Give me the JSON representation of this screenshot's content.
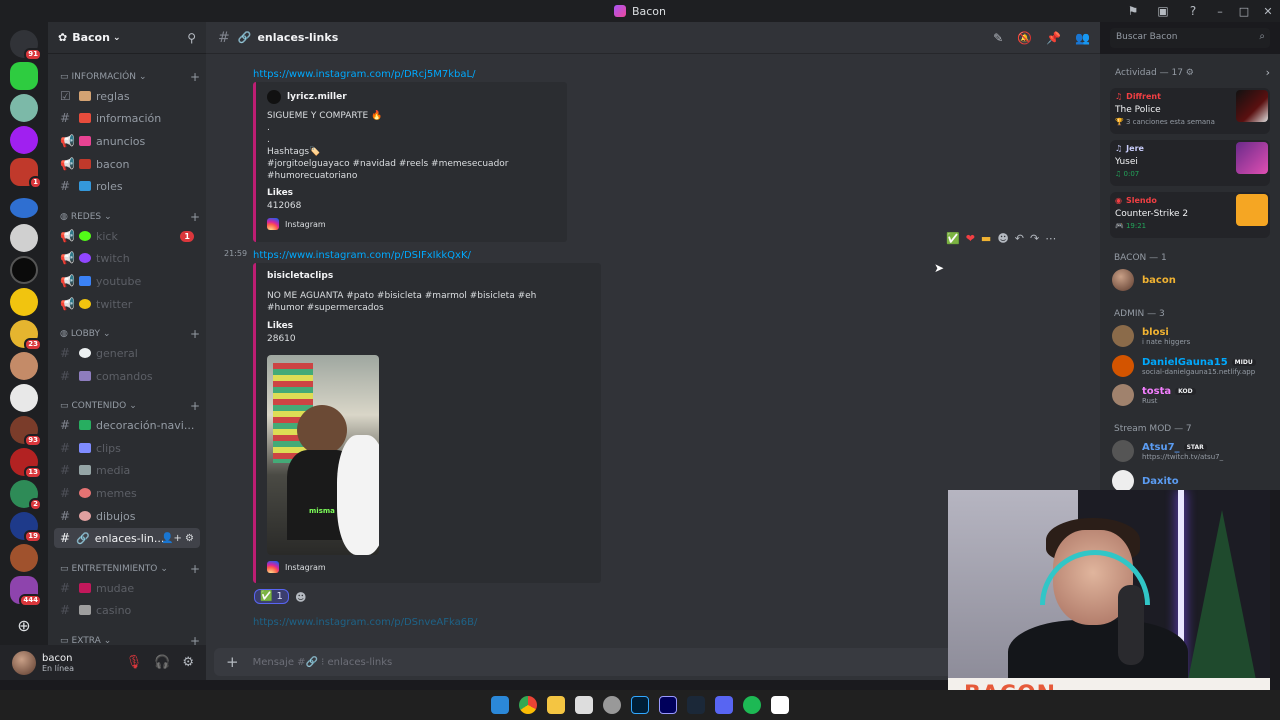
{
  "window": {
    "title": "Bacon"
  },
  "server": {
    "name": "Bacon"
  },
  "categories": [
    {
      "label": "INFORMACIÓN"
    },
    {
      "label": "REDES"
    },
    {
      "label": "LOBBY"
    },
    {
      "label": "CONTENIDO"
    },
    {
      "label": "ENTRETENIMIENTO"
    },
    {
      "label": "EXTRA"
    }
  ],
  "channels": [
    {
      "label": "reglas"
    },
    {
      "label": "información"
    },
    {
      "label": "anuncios"
    },
    {
      "label": "bacon"
    },
    {
      "label": "roles"
    },
    {
      "label": "kick",
      "count": "1"
    },
    {
      "label": "twitch"
    },
    {
      "label": "youtube"
    },
    {
      "label": "twitter"
    },
    {
      "label": "general"
    },
    {
      "label": "comandos"
    },
    {
      "label": "decoración-navi..."
    },
    {
      "label": "clips"
    },
    {
      "label": "media"
    },
    {
      "label": "memes"
    },
    {
      "label": "dibujos"
    },
    {
      "label": "enlaces-lin..."
    },
    {
      "label": "mudae"
    },
    {
      "label": "casino"
    }
  ],
  "user": {
    "name": "bacon",
    "status": "En línea"
  },
  "channel_header": {
    "name": "enlaces-links"
  },
  "search": {
    "placeholder": "Buscar Bacon"
  },
  "messages": {
    "link1": "https://www.instagram.com/p/DRcj5M7kbaL/",
    "embed1": {
      "author": "lyricz.miller",
      "line1": "SIGUEME Y COMPARTE 🔥",
      "dot1": ".",
      "dot2": ".",
      "hashtags_title": "Hashtags🏷️",
      "hashtags": "#jorgitoelguayaco #navidad #reels #memesecuador #humorecuatoriano",
      "field_name": "Likes",
      "field_value": "412068",
      "footer": "Instagram"
    },
    "time2": "21:59",
    "link2": "https://www.instagram.com/p/DSIFxIkkQxK/",
    "embed2": {
      "author": "bisicletaclips",
      "desc": "NO ME AGUANTA #pato #bisicleta #marmol #bisicleta #eh #humor #supermercados",
      "field_name": "Likes",
      "field_value": "28610",
      "image_caption": "misma",
      "footer": "Instagram"
    },
    "reaction": {
      "emoji": "✅",
      "count": "1"
    },
    "link3": "https://www.instagram.com/p/DSnveAFka6B/"
  },
  "composer": {
    "placeholder": "Mensaje #🔗 ⁝ enlaces-links"
  },
  "activity": {
    "header": "Actividad — 17",
    "items": [
      {
        "user": "Diffrent",
        "user_color": "#f23f43",
        "title": "The Police",
        "sub": "3 canciones esta semana"
      },
      {
        "user": "Jere",
        "user_color": "#c9cdfb",
        "title": "Yusei",
        "sub": "0:07"
      },
      {
        "user": "Slendo",
        "user_color": "#f23f43",
        "title": "Counter-Strike 2",
        "sub": "19:21"
      }
    ]
  },
  "member_groups": [
    {
      "label": "BACON — 1"
    },
    {
      "label": "ADMIN — 3"
    },
    {
      "label": "Stream MOD — 7"
    }
  ],
  "members": [
    {
      "name": "bacon",
      "color": "#f0b232",
      "sub": ""
    },
    {
      "name": "blosi",
      "color": "#f0b232",
      "sub": "i nate higgers"
    },
    {
      "name": "DanielGauna15",
      "color": "#00a8fc",
      "tag": "MIDU",
      "sub": "social-danielgauna15.netlify.app"
    },
    {
      "name": "tosta",
      "color": "#f47fff",
      "tag": "KOD",
      "sub": "Rust"
    },
    {
      "name": "Atsu7_",
      "color": "#5b9cf2",
      "tag": "STAR",
      "sub": "https://twitch.tv/atsu7_"
    },
    {
      "name": "Daxito",
      "color": "#5b9cf2",
      "sub": ""
    }
  ],
  "stream_overlay": {
    "banner": "BACON"
  },
  "colors": {
    "accent": "#5865f2",
    "embed_border": "#be1e73",
    "link": "#00a8fc"
  }
}
